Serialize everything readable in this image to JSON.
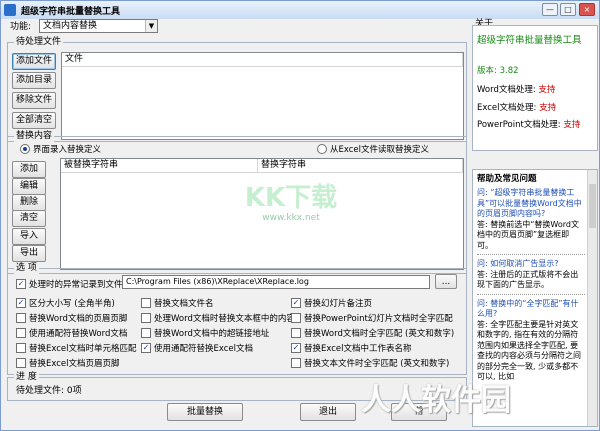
{
  "window": {
    "title": "超级字符串批量替换工具",
    "minimize_label": "—",
    "maximize_label": "□",
    "close_label": "×"
  },
  "function": {
    "label": "功能:",
    "value": "文档内容替换"
  },
  "files": {
    "group_title": "待处理文件",
    "buttons": {
      "add_file": "添加文件",
      "add_dir": "添加目录",
      "remove_file": "移除文件",
      "clear_all": "全部清空"
    },
    "column_header": "文件"
  },
  "replace": {
    "group_title": "替换内容",
    "radio_ui": "界面录入替换定义",
    "radio_excel": "从Excel文件读取替换定义",
    "buttons": {
      "add": "添加",
      "edit": "编辑",
      "delete": "删除",
      "clear": "清空",
      "import": "导入",
      "export": "导出"
    },
    "col_search": "被替换字符串",
    "col_replace": "替换字符串"
  },
  "options": {
    "group_title": "选  项",
    "error_log_label": "处理时的异常记录到文件:",
    "error_log_path": "C:\\Program Files (x86)\\XReplace\\XReplace.log",
    "browse_label": "...",
    "items": [
      "区分大小写 (全角半角)",
      "替换Word文档的页眉页脚",
      "使用通配符替换Word文档",
      "替换Excel文档时单元格匹配",
      "替换Excel文档页眉页脚",
      "替换文档文件名",
      "处理Word文档时替换文本框中的内容",
      "替换Word文档中的超链接地址",
      "使用通配符替换Excel文档",
      "替换幻灯片备注页",
      "替换PowerPoint幻灯片文档时全字匹配",
      "替换Word文档时全字匹配 (英文和数字)",
      "替换Excel文档中工作表名称",
      "替换文本文件时全字匹配 (英文和数字)"
    ]
  },
  "progress": {
    "group_title": "进  度",
    "status_text": "待处理文件: 0项"
  },
  "bottom": {
    "batch_replace": "批量替换",
    "exit": "退出",
    "third": "帮"
  },
  "about": {
    "group_title": "关于",
    "app_name": "超级字符串批量替换工具",
    "version_label": "版本: ",
    "version": "3.82",
    "word_label": "Word文档处理: ",
    "word_value": "支持",
    "excel_label": "Excel文档处理: ",
    "excel_value": "支持",
    "ppt_label": "PowerPoint文档处理: ",
    "ppt_value": "支持"
  },
  "help": {
    "title": "帮助及常见问题",
    "items": [
      {
        "q": "问: “超级字符串批量替换工具”可以批量替换Word文档中的页眉页脚内容吗?",
        "a": "答: 替换前选中“替换Word文档中的页眉页脚”复选框即可。"
      },
      {
        "q": "问: 如何取消广告显示?",
        "a": "答: 注册后的正式版将不会出现下面的广告显示。"
      },
      {
        "q": "问: 替换中的“全字匹配”有什么用?",
        "a": "答: 全字匹配主要是针对英文和数字的, 指在有效的分隔符范围内如果选择全字匹配, 要查找的内容必须与分隔符之间的部分完全一致, 少或多都不可以, 比如"
      }
    ]
  },
  "watermarks": {
    "center": "KK下载",
    "center_url": "www.kkx.net",
    "corner": "人人软件园"
  },
  "colors": {
    "accent_green": "#1a8a17",
    "support_red": "#d20000",
    "help_blue": "#1f4fb5"
  }
}
